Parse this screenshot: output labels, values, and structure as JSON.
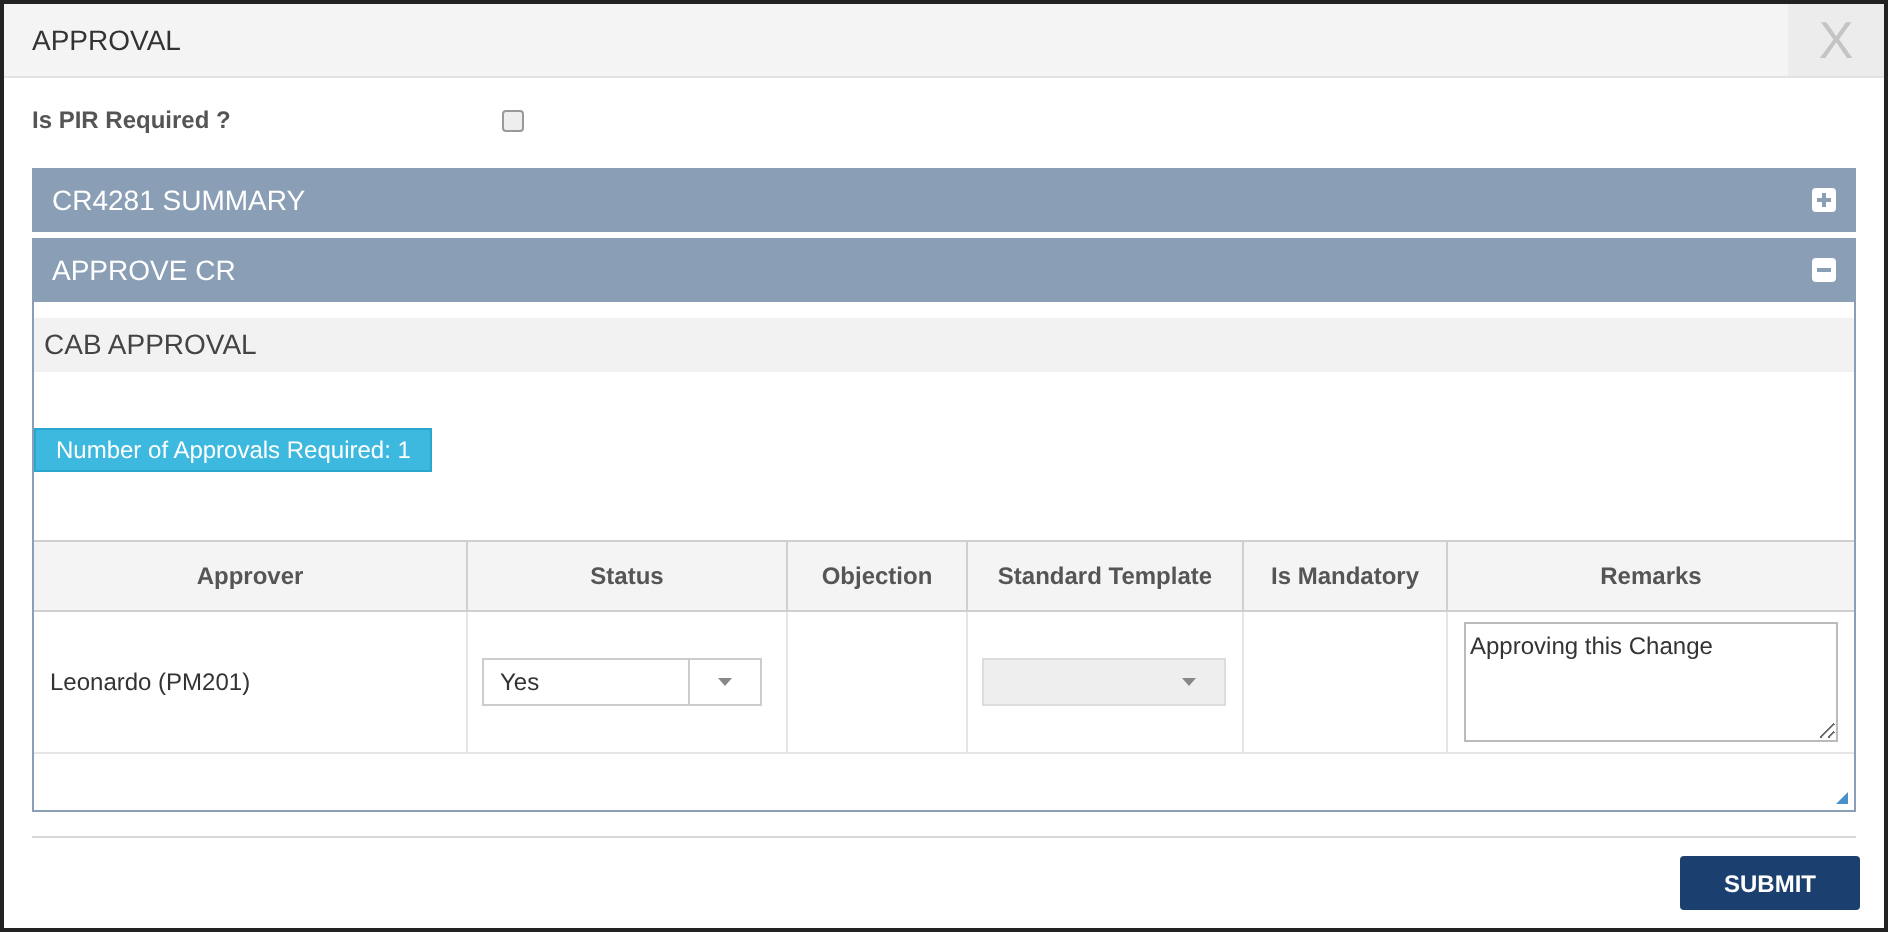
{
  "dialog": {
    "title": "APPROVAL",
    "close": "X"
  },
  "pir": {
    "label": "Is PIR Required ?",
    "checked": false
  },
  "panels": [
    {
      "title": "CR4281 SUMMARY",
      "expanded": false
    },
    {
      "title": "APPROVE CR",
      "expanded": true
    }
  ],
  "section": {
    "title": "CAB APPROVAL",
    "badge": "Number of Approvals Required: 1"
  },
  "table": {
    "columns": [
      "Approver",
      "Status",
      "Objection",
      "Standard Template",
      "Is Mandatory",
      "Remarks"
    ],
    "rows": [
      {
        "approver": "Leonardo (PM201)",
        "status": {
          "value": "Yes",
          "disabled": false
        },
        "template": {
          "disabled": true
        },
        "remarks": "Approving this Change"
      }
    ]
  },
  "submit": "SUBMIT"
}
